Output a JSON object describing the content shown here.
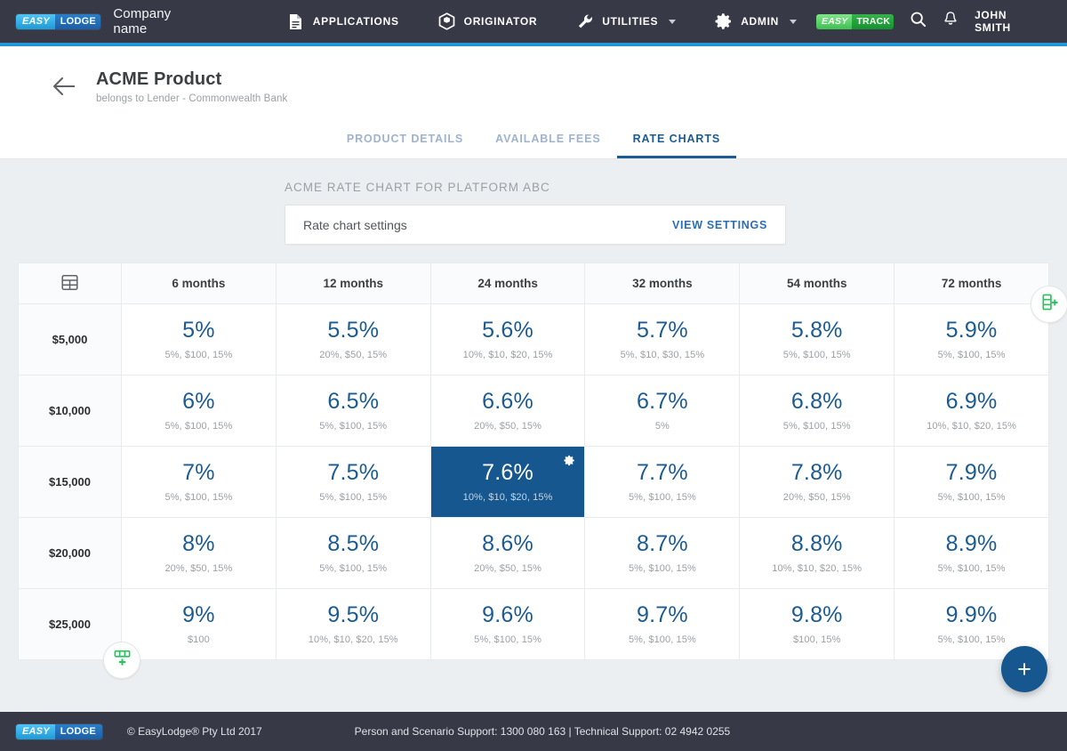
{
  "topbar": {
    "logo": {
      "part1": "EASY",
      "part2": "LODGE",
      "icon": "easylodge-logo"
    },
    "company_name": "Company name",
    "nav": [
      {
        "label": "APPLICATIONS",
        "icon": "document-icon",
        "has_caret": false
      },
      {
        "label": "ORIGINATOR",
        "icon": "cube-icon",
        "has_caret": false
      },
      {
        "label": "UTILITIES",
        "icon": "wrench-icon",
        "has_caret": true
      },
      {
        "label": "ADMIN",
        "icon": "gear-icon",
        "has_caret": true
      }
    ],
    "track_logo": {
      "part1": "EASY",
      "part2": "TRACK"
    },
    "search_icon": "search-icon",
    "bell_icon": "bell-icon",
    "user": "JOHN SMITH"
  },
  "page_header": {
    "back_icon": "back-arrow-icon",
    "title": "ACME Product",
    "subtitle": "belongs to Lender - Commonwealth Bank",
    "tabs": [
      {
        "label": "PRODUCT DETAILS",
        "active": false
      },
      {
        "label": "AVAILABLE FEES",
        "active": false
      },
      {
        "label": "RATE CHARTS",
        "active": true
      }
    ]
  },
  "main": {
    "section_title": "ACME RATE CHART FOR PLATFORM ABC",
    "settings_card": {
      "label": "Rate chart settings",
      "action_label": "VIEW SETTINGS"
    },
    "add_column_button": {
      "icon": "add-column-icon",
      "color": "#25c35b"
    },
    "add_row_button": {
      "icon": "add-row-icon",
      "color": "#25c35b"
    },
    "fab": {
      "label": "+",
      "color": "#17578f"
    },
    "selected_cell_gear_icon": "gear-icon"
  },
  "chart_data": {
    "type": "table",
    "title": "ACME RATE CHART FOR PLATFORM ABC",
    "corner_icon": "table-grid-icon",
    "columns": [
      "6 months",
      "12 months",
      "24 months",
      "32 months",
      "54 months",
      "72 months"
    ],
    "rows": [
      "$5,000",
      "$10,000",
      "$15,000",
      "$20,000",
      "$25,000"
    ],
    "cells": [
      [
        {
          "rate": "5%",
          "detail": "5%, $100, 15%",
          "selected": false
        },
        {
          "rate": "5.5%",
          "detail": "20%, $50, 15%",
          "selected": false
        },
        {
          "rate": "5.6%",
          "detail": "10%, $10, $20, 15%",
          "selected": false
        },
        {
          "rate": "5.7%",
          "detail": "5%, $10, $30, 15%",
          "selected": false
        },
        {
          "rate": "5.8%",
          "detail": "5%, $100, 15%",
          "selected": false
        },
        {
          "rate": "5.9%",
          "detail": "5%, $100, 15%",
          "selected": false
        }
      ],
      [
        {
          "rate": "6%",
          "detail": "5%, $100, 15%",
          "selected": false
        },
        {
          "rate": "6.5%",
          "detail": "5%, $100, 15%",
          "selected": false
        },
        {
          "rate": "6.6%",
          "detail": "20%, $50, 15%",
          "selected": false
        },
        {
          "rate": "6.7%",
          "detail": "5%",
          "selected": false
        },
        {
          "rate": "6.8%",
          "detail": "5%, $100, 15%",
          "selected": false
        },
        {
          "rate": "6.9%",
          "detail": "10%, $10, $20, 15%",
          "selected": false
        }
      ],
      [
        {
          "rate": "7%",
          "detail": "5%, $100, 15%",
          "selected": false
        },
        {
          "rate": "7.5%",
          "detail": "5%, $100, 15%",
          "selected": false
        },
        {
          "rate": "7.6%",
          "detail": "10%, $10, $20, 15%",
          "selected": true
        },
        {
          "rate": "7.7%",
          "detail": "5%, $100, 15%",
          "selected": false
        },
        {
          "rate": "7.8%",
          "detail": "20%, $50, 15%",
          "selected": false
        },
        {
          "rate": "7.9%",
          "detail": "5%, $100, 15%",
          "selected": false
        }
      ],
      [
        {
          "rate": "8%",
          "detail": "20%, $50, 15%",
          "selected": false
        },
        {
          "rate": "8.5%",
          "detail": "5%, $100, 15%",
          "selected": false
        },
        {
          "rate": "8.6%",
          "detail": "20%, $50, 15%",
          "selected": false
        },
        {
          "rate": "8.7%",
          "detail": "5%, $100, 15%",
          "selected": false
        },
        {
          "rate": "8.8%",
          "detail": "10%, $10, $20, 15%",
          "selected": false
        },
        {
          "rate": "8.9%",
          "detail": "5%, $100, 15%",
          "selected": false
        }
      ],
      [
        {
          "rate": "9%",
          "detail": "$100",
          "selected": false
        },
        {
          "rate": "9.5%",
          "detail": "10%, $10, $20, 15%",
          "selected": false
        },
        {
          "rate": "9.6%",
          "detail": "5%, $100, 15%",
          "selected": false
        },
        {
          "rate": "9.7%",
          "detail": "5%, $100, 15%",
          "selected": false
        },
        {
          "rate": "9.8%",
          "detail": "$100, 15%",
          "selected": false
        },
        {
          "rate": "9.9%",
          "detail": "5%, $100, 15%",
          "selected": false
        }
      ]
    ]
  },
  "footer": {
    "logo": {
      "part1": "EASY",
      "part2": "LODGE"
    },
    "copyright": "© EasyLodge® Pty Ltd 2017",
    "support": "Person and Scenario Support: 1300 080 163  |  Technical Support: 02 4942 0255"
  },
  "colors": {
    "nav_bg": "#373a46",
    "accent_blue": "#2196d8",
    "rate_blue": "#1b5b94",
    "selected_cell": "#17578f",
    "green": "#25c35b"
  }
}
